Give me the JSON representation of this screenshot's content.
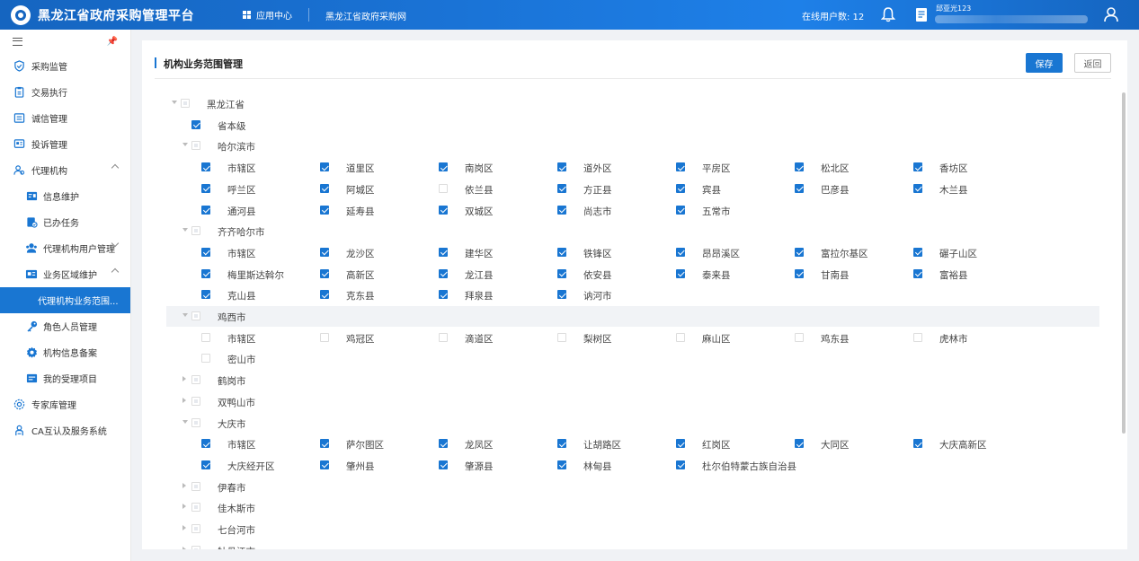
{
  "header": {
    "title": "黑龙江省政府采购管理平台",
    "app_center": "应用中心",
    "gov_link": "黑龙江省政府采购网",
    "online_users": "在线用户数: 12",
    "username": "邱亚光123"
  },
  "sidebar": {
    "items": [
      {
        "label": "采购监管",
        "icon": "shield-icon",
        "level": 1,
        "expandable": false
      },
      {
        "label": "交易执行",
        "icon": "clipboard-icon",
        "level": 1,
        "expandable": false
      },
      {
        "label": "诚信管理",
        "icon": "list-icon",
        "level": 1,
        "expandable": false
      },
      {
        "label": "投诉管理",
        "icon": "complaint-icon",
        "level": 1,
        "expandable": false
      },
      {
        "label": "代理机构",
        "icon": "agency-icon",
        "level": 1,
        "expandable": true,
        "expanded": true
      },
      {
        "label": "信息维护",
        "icon": "info-edit-icon",
        "level": 2,
        "expandable": false
      },
      {
        "label": "已办任务",
        "icon": "task-done-icon",
        "level": 2,
        "expandable": false
      },
      {
        "label": "代理机构用户管理",
        "icon": "users-icon",
        "level": 2,
        "expandable": true,
        "expanded": false
      },
      {
        "label": "业务区域维护",
        "icon": "area-icon",
        "level": 2,
        "expandable": true,
        "expanded": true
      },
      {
        "label": "代理机构业务范围...",
        "icon": "",
        "level": 3,
        "active": true
      },
      {
        "label": "角色人员管理",
        "icon": "key-icon",
        "level": 2,
        "expandable": false
      },
      {
        "label": "机构信息备案",
        "icon": "settings-icon",
        "level": 2,
        "expandable": false
      },
      {
        "label": "我的受理项目",
        "icon": "project-icon",
        "level": 2,
        "expandable": false
      },
      {
        "label": "专家库管理",
        "icon": "gear-icon",
        "level": 1,
        "expandable": false
      },
      {
        "label": "CA互认及服务系统",
        "icon": "ca-icon",
        "level": 1,
        "expandable": false
      }
    ]
  },
  "panel": {
    "title": "机构业务范围管理",
    "save_label": "保存",
    "back_label": "返回"
  },
  "tree": {
    "root": "黑龙江省",
    "provincial": "省本级",
    "cities": [
      {
        "name": "哈尔滨市",
        "expanded": true,
        "children": [
          {
            "name": "市辖区",
            "checked": true
          },
          {
            "name": "道里区",
            "checked": true
          },
          {
            "name": "南岗区",
            "checked": true
          },
          {
            "name": "道外区",
            "checked": true
          },
          {
            "name": "平房区",
            "checked": true
          },
          {
            "name": "松北区",
            "checked": true
          },
          {
            "name": "香坊区",
            "checked": true
          },
          {
            "name": "呼兰区",
            "checked": true
          },
          {
            "name": "阿城区",
            "checked": true
          },
          {
            "name": "依兰县",
            "checked": false
          },
          {
            "name": "方正县",
            "checked": true
          },
          {
            "name": "宾县",
            "checked": true
          },
          {
            "name": "巴彦县",
            "checked": true
          },
          {
            "name": "木兰县",
            "checked": true
          },
          {
            "name": "通河县",
            "checked": true
          },
          {
            "name": "延寿县",
            "checked": true
          },
          {
            "name": "双城区",
            "checked": true
          },
          {
            "name": "尚志市",
            "checked": true
          },
          {
            "name": "五常市",
            "checked": true
          }
        ]
      },
      {
        "name": "齐齐哈尔市",
        "expanded": true,
        "children": [
          {
            "name": "市辖区",
            "checked": true
          },
          {
            "name": "龙沙区",
            "checked": true
          },
          {
            "name": "建华区",
            "checked": true
          },
          {
            "name": "铁锋区",
            "checked": true
          },
          {
            "name": "昂昂溪区",
            "checked": true
          },
          {
            "name": "富拉尔基区",
            "checked": true
          },
          {
            "name": "碾子山区",
            "checked": true
          },
          {
            "name": "梅里斯达斡尔",
            "checked": true
          },
          {
            "name": "高新区",
            "checked": true
          },
          {
            "name": "龙江县",
            "checked": true
          },
          {
            "name": "依安县",
            "checked": true
          },
          {
            "name": "泰来县",
            "checked": true
          },
          {
            "name": "甘南县",
            "checked": true
          },
          {
            "name": "富裕县",
            "checked": true
          },
          {
            "name": "克山县",
            "checked": true
          },
          {
            "name": "克东县",
            "checked": true
          },
          {
            "name": "拜泉县",
            "checked": true
          },
          {
            "name": "讷河市",
            "checked": true
          }
        ]
      },
      {
        "name": "鸡西市",
        "expanded": true,
        "highlight": true,
        "children": [
          {
            "name": "市辖区",
            "checked": false
          },
          {
            "name": "鸡冠区",
            "checked": false
          },
          {
            "name": "滴道区",
            "checked": false
          },
          {
            "name": "梨树区",
            "checked": false
          },
          {
            "name": "麻山区",
            "checked": false
          },
          {
            "name": "鸡东县",
            "checked": false
          },
          {
            "name": "虎林市",
            "checked": false
          },
          {
            "name": "密山市",
            "checked": false
          }
        ]
      },
      {
        "name": "鹤岗市",
        "expanded": false,
        "children": []
      },
      {
        "name": "双鸭山市",
        "expanded": false,
        "children": []
      },
      {
        "name": "大庆市",
        "expanded": true,
        "children": [
          {
            "name": "市辖区",
            "checked": true
          },
          {
            "name": "萨尔图区",
            "checked": true
          },
          {
            "name": "龙凤区",
            "checked": true
          },
          {
            "name": "让胡路区",
            "checked": true
          },
          {
            "name": "红岗区",
            "checked": true
          },
          {
            "name": "大同区",
            "checked": true
          },
          {
            "name": "大庆高新区",
            "checked": true
          },
          {
            "name": "大庆经开区",
            "checked": true
          },
          {
            "name": "肇州县",
            "checked": true
          },
          {
            "name": "肇源县",
            "checked": true
          },
          {
            "name": "林甸县",
            "checked": true
          },
          {
            "name": "杜尔伯特蒙古族自治县",
            "checked": true
          }
        ]
      },
      {
        "name": "伊春市",
        "expanded": false,
        "children": []
      },
      {
        "name": "佳木斯市",
        "expanded": false,
        "children": []
      },
      {
        "name": "七台河市",
        "expanded": false,
        "children": []
      },
      {
        "name": "牡丹江市",
        "expanded": false,
        "children": []
      }
    ]
  }
}
